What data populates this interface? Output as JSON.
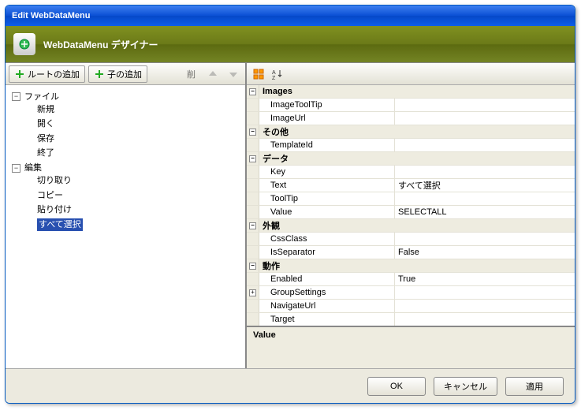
{
  "window": {
    "title": "Edit WebDataMenu"
  },
  "header": {
    "title": "WebDataMenu デザイナー",
    "icon": "menu-designer-icon"
  },
  "toolbar": {
    "add_root": "ルートの追加",
    "add_child": "子の追加",
    "delete": "削",
    "add_root_icon": "plus-green-icon",
    "add_child_icon": "plus-green-icon"
  },
  "tree": {
    "items": [
      {
        "label": "ファイル",
        "expanded": true,
        "children": [
          {
            "label": "新規"
          },
          {
            "label": "開く"
          },
          {
            "label": "保存"
          },
          {
            "label": "終了"
          }
        ]
      },
      {
        "label": "編集",
        "expanded": true,
        "children": [
          {
            "label": "切り取り"
          },
          {
            "label": "コピー"
          },
          {
            "label": "貼り付け"
          },
          {
            "label": "すべて選択",
            "selected": true
          }
        ]
      }
    ]
  },
  "prop_toolbar": {
    "categorized_icon": "categorized-icon",
    "alpha_sort_icon": "alpha-sort-icon"
  },
  "properties": {
    "categories": [
      {
        "name": "Images",
        "expanded": true,
        "rows": [
          {
            "name": "ImageToolTip",
            "value": ""
          },
          {
            "name": "ImageUrl",
            "value": ""
          }
        ]
      },
      {
        "name": "その他",
        "expanded": true,
        "rows": [
          {
            "name": "TemplateId",
            "value": ""
          }
        ]
      },
      {
        "name": "データ",
        "expanded": true,
        "rows": [
          {
            "name": "Key",
            "value": ""
          },
          {
            "name": "Text",
            "value": "すべて選択"
          },
          {
            "name": "ToolTip",
            "value": ""
          },
          {
            "name": "Value",
            "value": "SELECTALL"
          }
        ]
      },
      {
        "name": "外観",
        "expanded": true,
        "rows": [
          {
            "name": "CssClass",
            "value": ""
          },
          {
            "name": "IsSeparator",
            "value": "False"
          }
        ]
      },
      {
        "name": "動作",
        "expanded": true,
        "rows": [
          {
            "name": "Enabled",
            "value": "True"
          },
          {
            "name": "GroupSettings",
            "value": "",
            "expandable": true
          },
          {
            "name": "NavigateUrl",
            "value": ""
          },
          {
            "name": "Target",
            "value": ""
          }
        ]
      }
    ]
  },
  "description": {
    "title": "Value"
  },
  "buttons": {
    "ok": "OK",
    "cancel": "キャンセル",
    "apply": "適用"
  }
}
